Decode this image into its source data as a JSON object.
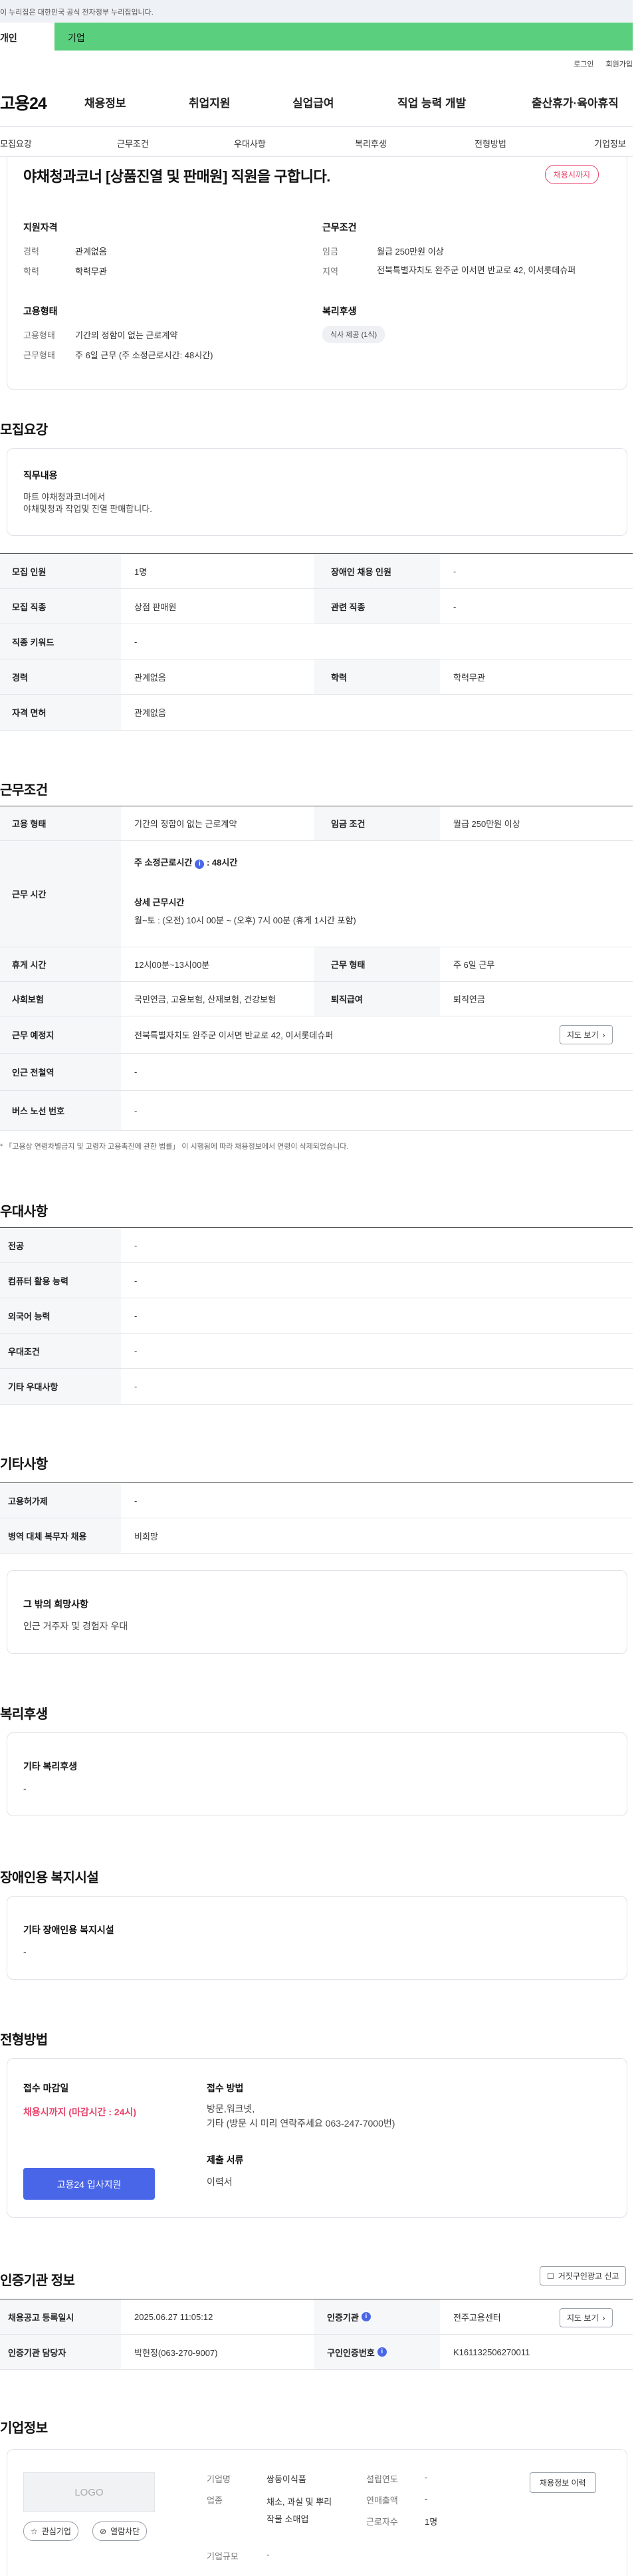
{
  "gov_banner": "이 누리집은 대한민국 공식 전자정부 누리집입니다.",
  "user_tabs": {
    "individual": "개인",
    "enterprise": "기업"
  },
  "util": {
    "login": "로그인",
    "join": "회원가입"
  },
  "logo": "고용24",
  "gnav": [
    "채용정보",
    "취업지원",
    "실업급여",
    "직업 능력 개발",
    "출산휴가·육아휴직"
  ],
  "subnav": [
    "모집요강",
    "근무조건",
    "우대사항",
    "복리후생",
    "전형방법",
    "기업정보"
  ],
  "summary": {
    "title": "야채청과코너 [상품진열 및 판매원] 직원을 구합니다.",
    "status": "채용시까지",
    "qual_h": "지원자격",
    "career_l": "경력",
    "career_v": "관계없음",
    "edu_l": "학력",
    "edu_v": "학력무관",
    "emp_h": "고용형태",
    "emptype_l": "고용형태",
    "emptype_v": "기간의 정함이 없는 근로계약",
    "worktype_l": "근무형태",
    "worktype_v": "주 6일 근무 (주 소정근로시간: 48시간)",
    "cond_h": "근무조건",
    "wage_l": "임금",
    "wage_v": "월급 250만원 이상",
    "region_l": "지역",
    "region_v": "전북특별자치도 완주군 이서면 반교로 42, 이서롯데슈퍼",
    "welfare_h": "복리후생",
    "welfare_pill": "식사 제공 (1식)"
  },
  "recruit": {
    "heading": "모집요강",
    "duty_h": "직무내용",
    "duty_text": "마트 야채청과코너에서\n야채및청과 작업및 진열 판매합니다.",
    "rows": [
      {
        "l1": "모집 인원",
        "v1": "1명",
        "l2": "장애인 채용 인원",
        "v2": "-"
      },
      {
        "l1": "모집 직종",
        "v1": "상점 판매원",
        "l2": "관련 직종",
        "v2": "-"
      },
      {
        "l1": "직종 키워드",
        "v1": "-"
      },
      {
        "l1": "경력",
        "v1": "관계없음",
        "l2": "학력",
        "v2": "학력무관"
      },
      {
        "l1": "자격 면허",
        "v1": "관계없음"
      }
    ]
  },
  "work": {
    "heading": "근무조건",
    "emp_l": "고용 형태",
    "emp_v": "기간의 정함이 없는 근로계약",
    "wage_l": "임금 조건",
    "wage_v": "월급 250만원 이상",
    "time_l": "근무 시간",
    "time_weekly": "주 소정근로시간",
    "time_weekly_v": "48시간",
    "time_detail_h": "상세 근무시간",
    "time_detail_v": "월~토 :  (오전) 10시 00분 ~ (오후) 7시 00분 (휴게 1시간 포함)",
    "rest_l": "휴게 시간",
    "rest_v": "12시00분~13시00분",
    "shape_l": "근무 형태",
    "shape_v": "주 6일 근무",
    "ins_l": "사회보험",
    "ins_v": "국민연금, 고용보험, 산재보험, 건강보험",
    "sev_l": "퇴직급여",
    "sev_v": "퇴직연금",
    "place_l": "근무 예정지",
    "place_v": "전북특별자치도 완주군 이서면 반교로 42, 이서롯데슈퍼",
    "map_btn": "지도 보기",
    "subway_l": "인근 전철역",
    "subway_v": "-",
    "bus_l": "버스 노선 번호",
    "bus_v": "-",
    "note": "* 「고용상 연령차별금지 및 고령자 고용촉진에 관한 법률」 이 시행됨에 따라 채용정보에서 연령이 삭제되었습니다."
  },
  "pref": {
    "heading": "우대사항",
    "rows": [
      {
        "l": "전공",
        "v": "-"
      },
      {
        "l": "컴퓨터 활용 능력",
        "v": "-"
      },
      {
        "l": "외국어 능력",
        "v": "-"
      },
      {
        "l": "우대조건",
        "v": "-"
      },
      {
        "l": "기타 우대사항",
        "v": "-"
      }
    ]
  },
  "etc": {
    "heading": "기타사항",
    "rows": [
      {
        "l": "고용허가제",
        "v": "-"
      },
      {
        "l": "병역 대체 복무자 채용",
        "v": "비희망"
      }
    ],
    "hope_h": "그 밖의 희망사항",
    "hope_v": "인근 거주자 및 경험자 우대"
  },
  "benefit": {
    "heading": "복리후생",
    "box_h": "기타 복리후생",
    "box_v": "-"
  },
  "disab": {
    "heading": "장애인용 복지시설",
    "box_h": "기타 장애인용 복지시설",
    "box_v": "-"
  },
  "selection": {
    "heading": "전형방법",
    "deadline_h": "접수 마감일",
    "deadline_v": "채용시까지 (마감시간 : 24시)",
    "apply_btn": "고용24 입사지원",
    "method_h": "접수 방법",
    "method_v": "방문,워크넷,\n기타 (방문 시 미리 연락주세요 063-247-7000번)",
    "docs_h": "제출 서류",
    "docs_v": "이력서"
  },
  "cert": {
    "heading": "인증기관 정보",
    "report_btn": "거짓구인광고 신고",
    "reg_l": "채용공고 등록일시",
    "reg_v": "2025.06.27 11:05:12",
    "org_l": "인증기관",
    "org_v": "전주고용센터",
    "map_btn": "지도 보기",
    "mgr_l": "인증기관 담당자",
    "mgr_v": "박현정(063-270-9007)",
    "num_l": "구인인증번호",
    "num_v": "K161132506270011"
  },
  "company": {
    "heading": "기업정보",
    "logo_text": "LOGO",
    "fav_btn": "관심기업",
    "block_btn": "열람차단",
    "name_l": "기업명",
    "name_v": "쌍둥이식품",
    "ind_l": "업종",
    "ind_v": "채소, 과실 및 뿌리작물 소매업",
    "size_l": "기업규모",
    "size_v": "-",
    "est_l": "설립연도",
    "est_v": "-",
    "sales_l": "연매출액",
    "sales_v": "-",
    "emp_l": "근로자수",
    "emp_v": "1명",
    "history_btn": "채용정보 이력"
  },
  "colors": {
    "primary": "#4a66e8",
    "green": "#5ad07e",
    "alert": "#e8456b"
  }
}
